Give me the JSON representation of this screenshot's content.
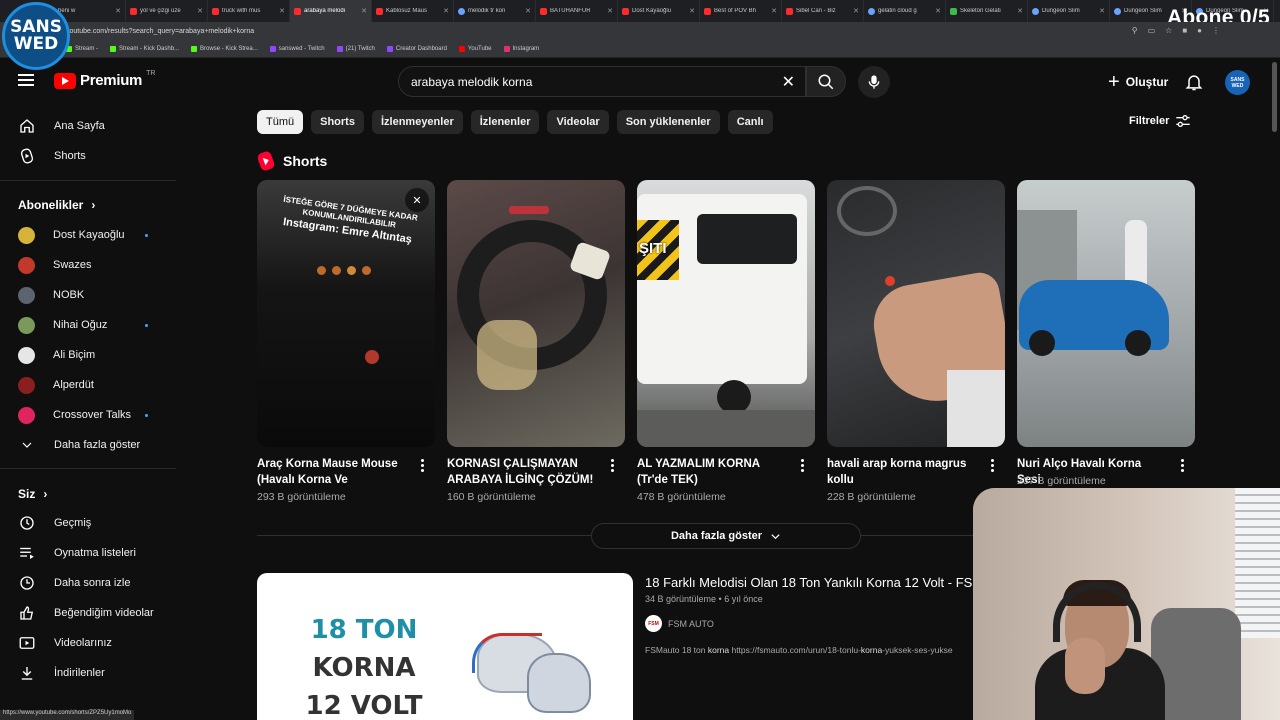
{
  "overlay": {
    "logo_line1": "SANS",
    "logo_line2": "WED",
    "abone_counter": "Abone 0/5"
  },
  "browser": {
    "tabs": [
      {
        "label": "beni w",
        "fav": "yt"
      },
      {
        "label": "yol ve çizgi üze",
        "fav": "yt"
      },
      {
        "label": "truck with mus",
        "fav": "yt"
      },
      {
        "label": "arabaya melodi",
        "fav": "yt",
        "active": true
      },
      {
        "label": "Kablosuz Maus",
        "fav": "yt"
      },
      {
        "label": "melodik tr kon",
        "fav": "g"
      },
      {
        "label": "BATUHANFUR",
        "fav": "yt"
      },
      {
        "label": "Dost Kayaoğlu",
        "fav": "yt"
      },
      {
        "label": "Best of POV Bh",
        "fav": "yt"
      },
      {
        "label": "Sibel Can - Biz",
        "fav": "yt"
      },
      {
        "label": "gelatin cloud g",
        "fav": "g"
      },
      {
        "label": "Skeleton Gelati",
        "fav": "gr"
      },
      {
        "label": "Dungeon Slim",
        "fav": "g"
      },
      {
        "label": "Dungeon Slim",
        "fav": "g"
      },
      {
        "label": "Dungeon Slim",
        "fav": "g"
      }
    ],
    "url": "youtube.com/results?search_query=arabaya+melodik+korna",
    "bookmarks": [
      {
        "label": "Stream -",
        "icon": "k"
      },
      {
        "label": "Stream - Kick Dashb...",
        "icon": "k"
      },
      {
        "label": "Browse - Kick Strea...",
        "icon": "k"
      },
      {
        "label": "sanswed - Twitch",
        "icon": "t"
      },
      {
        "label": "(21) Twitch",
        "icon": "t"
      },
      {
        "label": "Creator Dashboard",
        "icon": "t"
      },
      {
        "label": "YouTube",
        "icon": "y"
      },
      {
        "label": "Instagram",
        "icon": "i"
      }
    ],
    "status_url": "https://www.youtube.com/shorts/ZPZ5Uy1moMo"
  },
  "header": {
    "logo_text": "Premium",
    "country": "TR",
    "search_value": "arabaya melodik korna",
    "create_label": "Oluştur",
    "avatar_text": "SANS WED"
  },
  "sidebar": {
    "main": [
      {
        "label": "Ana Sayfa",
        "icon": "home-icon"
      },
      {
        "label": "Shorts",
        "icon": "shorts-icon"
      }
    ],
    "subs_heading": "Abonelikler",
    "subscriptions": [
      {
        "label": "Dost Kayaoğlu",
        "color": "#d6b33a",
        "dot": true
      },
      {
        "label": "Swazes",
        "color": "#c0392b",
        "dot": false
      },
      {
        "label": "NOBK",
        "color": "#5c6470",
        "dot": false
      },
      {
        "label": "Nihai Oğuz",
        "color": "#7a9a5b",
        "dot": true
      },
      {
        "label": "Ali Biçim",
        "color": "#e6e6e6",
        "dot": false
      },
      {
        "label": "Alperdüt",
        "color": "#8b1e1e",
        "dot": false
      },
      {
        "label": "Crossover Talks",
        "color": "#e0245e",
        "dot": true
      }
    ],
    "show_more": "Daha fazla göster",
    "you_heading": "Siz",
    "you_items": [
      {
        "label": "Geçmiş",
        "icon": "history-icon"
      },
      {
        "label": "Oynatma listeleri",
        "icon": "playlist-icon"
      },
      {
        "label": "Daha sonra izle",
        "icon": "watch-later-icon"
      },
      {
        "label": "Beğendiğim videolar",
        "icon": "like-icon"
      },
      {
        "label": "Videolarınız",
        "icon": "your-videos-icon"
      },
      {
        "label": "İndirilenler",
        "icon": "download-icon"
      }
    ]
  },
  "chips": [
    "Tümü",
    "Shorts",
    "İzlenmeyenler",
    "İzlenenler",
    "Videolar",
    "Son yüklenenler",
    "Canlı"
  ],
  "filters_label": "Filtreler",
  "shorts": {
    "heading": "Shorts",
    "items": [
      {
        "title": "Araç Korna Mause Mouse (Havalı Korna Ve Kornalar...",
        "views": "293 B görüntüleme",
        "overlay_line1": "İSTEĞE GÖRE 7 DÜĞMEYE KADAR",
        "overlay_line2": "KONUMLANDIRILABILIR",
        "overlay_line3": "Instagram: Emre Altıntaş"
      },
      {
        "title": "KORNASI ÇALIŞMAYAN ARABAYA İLGİNÇ ÇÖZÜM!",
        "views": "160 B görüntüleme"
      },
      {
        "title": "AL YAZMALIM KORNA (Tr'de TEK)",
        "views": "478 B görüntüleme",
        "overlay_line1": "ŞITI"
      },
      {
        "title": "havali arap korna magrus kollu",
        "views": "228 B görüntüleme"
      },
      {
        "title": "Nuri Alço Havalı Korna Sesi",
        "views": "237 B görüntüleme"
      }
    ],
    "more_label": "Daha fazla göster"
  },
  "video": {
    "title": "18 Farklı Melodisi Olan 18 Ton Yankılı Korna 12 Volt - FS",
    "meta": "34 B görüntüleme • 6 yıl önce",
    "channel": "FSM AUTO",
    "channel_avatar": "FSM",
    "desc_pre": "FSMauto 18 ton ",
    "desc_bold": "korna",
    "desc_mid": " https://fsmauto.com/urun/18-tonlu-",
    "desc_bold2": "korna",
    "desc_post": "-yuksek-ses-yukse",
    "thumb_line1": "18 TON",
    "thumb_line2": "KORNA",
    "thumb_line3": "12 VOLT"
  }
}
